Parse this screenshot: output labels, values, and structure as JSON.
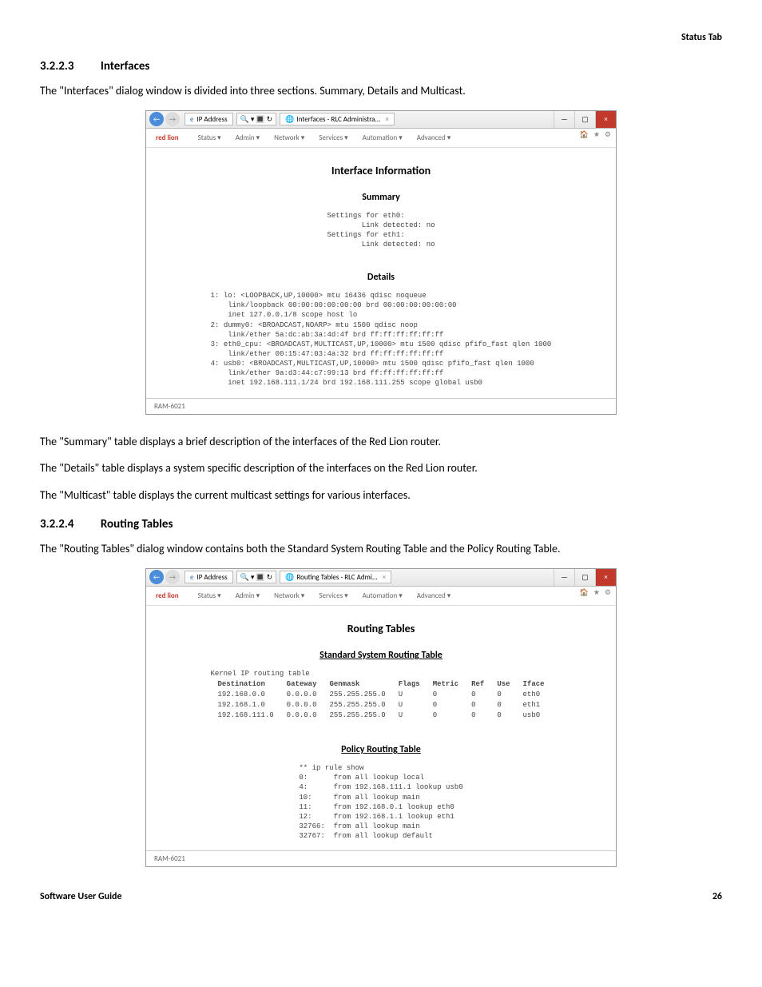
{
  "header_right": "Status Tab",
  "s1": {
    "num": "3.2.2.3",
    "title": "Interfaces",
    "intro": "The \"Interfaces\" dialog window is divided into three sections. Summary, Details and Multicast.",
    "summary_line": "The \"Summary\" table displays a brief description of the interfaces of the Red Lion router.",
    "details_line": "The \"Details\" table displays a system specific description of the interfaces on the Red Lion router.",
    "multicast_line": "The \"Multicast\" table displays the current multicast settings for various interfaces."
  },
  "s2": {
    "num": "3.2.2.4",
    "title": "Routing Tables",
    "intro": "The \"Routing Tables\" dialog window contains both the Standard System Routing Table and the Policy Routing Table."
  },
  "shot1": {
    "address": "IP Address",
    "tab": "Interfaces - RLC Administra...",
    "brand": "red lion",
    "menus": [
      "Status",
      "Admin",
      "Network",
      "Services",
      "Automation",
      "Advanced"
    ],
    "title": "Interface Information",
    "summary_label": "Summary",
    "summary_text": "Settings for eth0:\n        Link detected: no\nSettings for eth1:\n        Link detected: no",
    "details_label": "Details",
    "details_text": "1: lo: <LOOPBACK,UP,10000> mtu 16436 qdisc noqueue\n    link/loopback 00:00:00:00:00:00 brd 00:00:00:00:00:00\n    inet 127.0.0.1/8 scope host lo\n2: dummy0: <BROADCAST,NOARP> mtu 1500 qdisc noop\n    link/ether 5a:dc:ab:3a:4d:4f brd ff:ff:ff:ff:ff:ff\n3: eth0_cpu: <BROADCAST,MULTICAST,UP,10000> mtu 1500 qdisc pfifo_fast qlen 1000\n    link/ether 00:15:47:03:4a:32 brd ff:ff:ff:ff:ff:ff\n4: usb0: <BROADCAST,MULTICAST,UP,10000> mtu 1500 qdisc pfifo_fast qlen 1000\n    link/ether 9a:d3:44:c7:99:13 brd ff:ff:ff:ff:ff:ff\n    inet 192.168.111.1/24 brd 192.168.111.255 scope global usb0",
    "footer": "RAM-6021"
  },
  "shot2": {
    "address": "IP Address",
    "tab": "Routing Tables - RLC Admi...",
    "brand": "red lion",
    "menus": [
      "Status",
      "Admin",
      "Network",
      "Services",
      "Automation",
      "Advanced"
    ],
    "title": "Routing Tables",
    "std_label": "Standard System Routing Table",
    "std_caption": "Kernel IP routing table",
    "std_headers": [
      "Destination",
      "Gateway",
      "Genmask",
      "Flags",
      "Metric",
      "Ref",
      "Use",
      "Iface"
    ],
    "std_rows": [
      [
        "192.168.0.0",
        "0.0.0.0",
        "255.255.255.0",
        "U",
        "0",
        "0",
        "0",
        "eth0"
      ],
      [
        "192.168.1.0",
        "0.0.0.0",
        "255.255.255.0",
        "U",
        "0",
        "0",
        "0",
        "eth1"
      ],
      [
        "192.168.111.0",
        "0.0.0.0",
        "255.255.255.0",
        "U",
        "0",
        "0",
        "0",
        "usb0"
      ]
    ],
    "pol_label": "Policy Routing Table",
    "pol_text": "** ip rule show\n0:      from all lookup local\n4:      from 192.168.111.1 lookup usb0\n10:     from all lookup main\n11:     from 192.168.0.1 lookup eth0\n12:     from 192.168.1.1 lookup eth1\n32766:  from all lookup main\n32767:  from all lookup default",
    "footer": "RAM-6021"
  },
  "footer": {
    "left": "Software User Guide",
    "right": "26"
  }
}
